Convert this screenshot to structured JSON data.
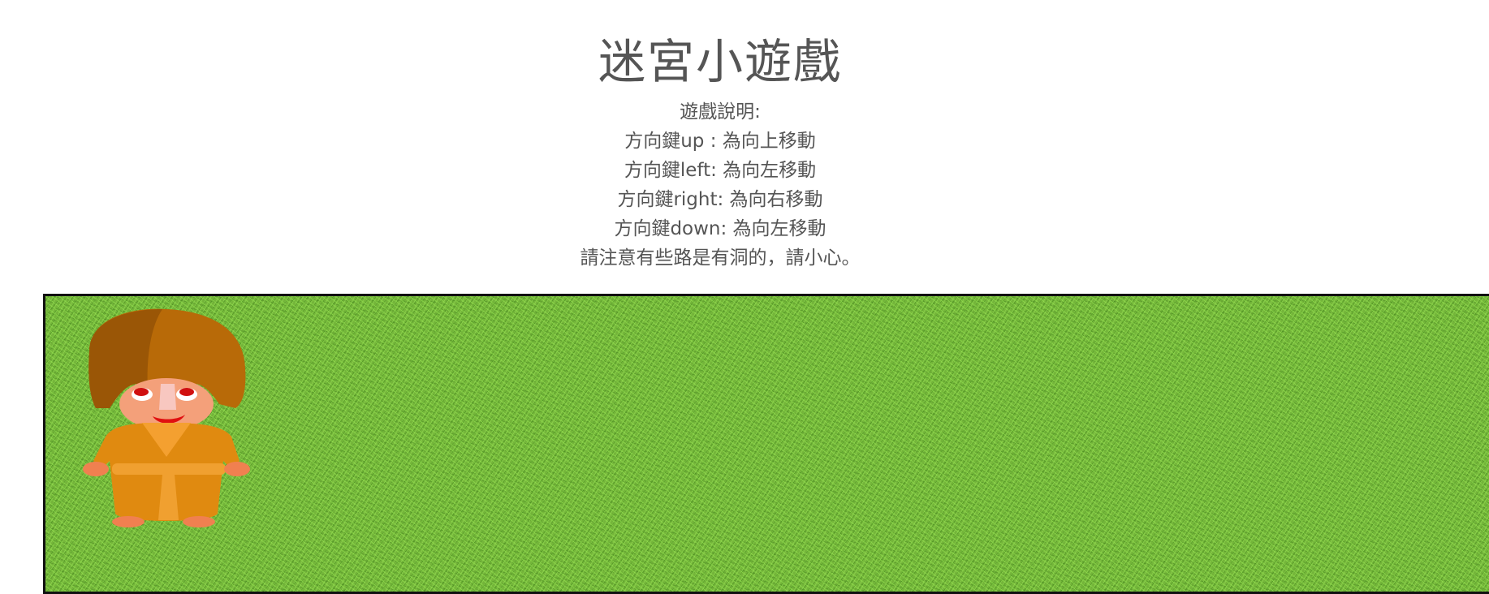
{
  "page": {
    "title": "迷宮小遊戲",
    "instructions": [
      "遊戲說明:",
      "方向鍵up : 為向上移動",
      "方向鍵left: 為向左移動",
      "方向鍵right: 為向右移動",
      "方向鍵down: 為向左移動",
      "請注意有些路是有洞的，請小心。"
    ]
  },
  "game": {
    "board_texture": "grass",
    "player_sprite": "monk-character",
    "colors": {
      "grass": "#74b53a",
      "border": "#111111",
      "robe": "#e08a10",
      "hair": "#b86a08",
      "skin": "#f4a07a"
    }
  }
}
